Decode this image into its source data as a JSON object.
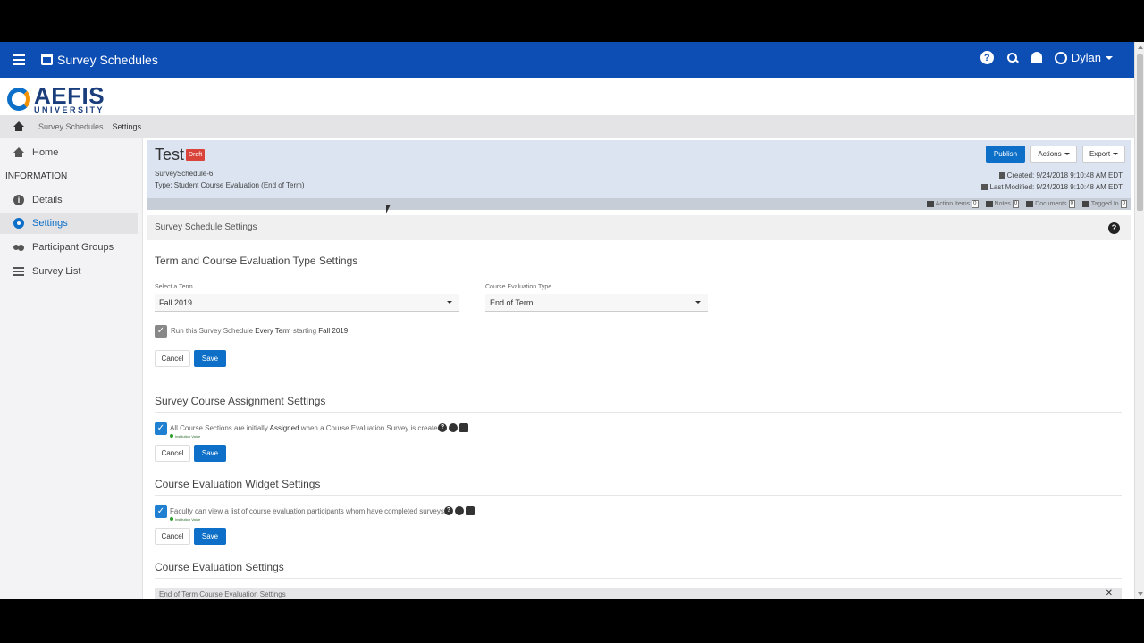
{
  "topbar": {
    "title": "Survey Schedules",
    "user_name": "Dylan",
    "icons": [
      "menu-icon",
      "calendar-icon",
      "help-icon",
      "search-icon",
      "bell-icon",
      "user-icon"
    ],
    "bg_color": "#0d4eb5"
  },
  "logo": {
    "main": "AEFIS",
    "sub": "UNIVERSITY"
  },
  "breadcrumb": {
    "items": [
      "Survey Schedules",
      "Settings"
    ]
  },
  "sidebar": {
    "home": "Home",
    "section_heading": "INFORMATION",
    "items": [
      {
        "label": "Details",
        "icon": "info-icon"
      },
      {
        "label": "Settings",
        "icon": "gear-icon",
        "active": true
      },
      {
        "label": "Participant Groups",
        "icon": "people-icon"
      },
      {
        "label": "Survey List",
        "icon": "list-icon"
      }
    ]
  },
  "header": {
    "title": "Test",
    "badge": "Draft",
    "id": "SurveySchedule-6",
    "type": "Type: Student Course Evaluation (End of Term)",
    "publish": "Publish",
    "actions": "Actions",
    "export": "Export",
    "created": "Created: 9/24/2018 9:10:48 AM EDT",
    "modified": "Last Modified: 9/24/2018 9:10:48 AM EDT",
    "meta": [
      {
        "label": "Action Items",
        "count": "0"
      },
      {
        "label": "Notes",
        "count": "0"
      },
      {
        "label": "Documents",
        "count": "0"
      },
      {
        "label": "Tagged In",
        "count": "0"
      }
    ]
  },
  "settings_header": "Survey Schedule Settings",
  "term_section": {
    "title": "Term and Course Evaluation Type Settings",
    "term_label": "Select a Term",
    "term_value": "Fall 2019",
    "type_label": "Course Evaluation Type",
    "type_value": "End of Term",
    "run_prefix": "Run this Survey Schedule ",
    "run_bold": "Every Term",
    "run_mid": " starting ",
    "run_term": "Fall 2019",
    "cancel": "Cancel",
    "save": "Save"
  },
  "assignment_section": {
    "title": "Survey Course Assignment Settings",
    "text_prefix": "All Course Sections are initially ",
    "text_bold": "Assigned",
    "text_suffix": " when a Course Evaluation Survey is created.",
    "inst": "Institution Value",
    "cancel": "Cancel",
    "save": "Save"
  },
  "widget_section": {
    "title": "Course Evaluation Widget Settings",
    "text": "Faculty can view a list of course evaluation participants whom have completed surveys.",
    "inst": "Institution Value",
    "cancel": "Cancel",
    "save": "Save"
  },
  "evaluation_section": {
    "title": "Course Evaluation Settings",
    "accordion": "End of Term Course Evaluation Settings"
  }
}
